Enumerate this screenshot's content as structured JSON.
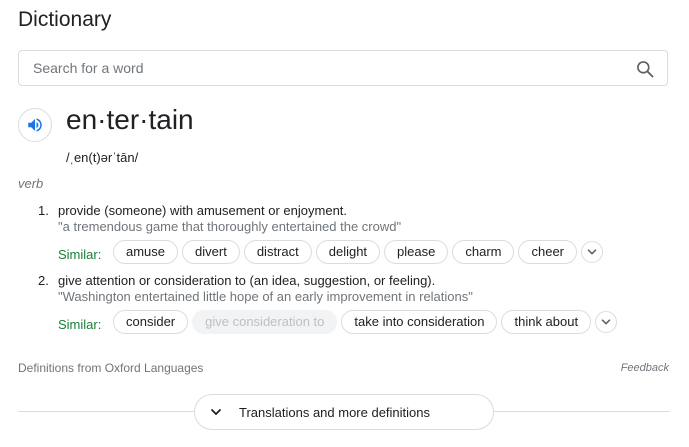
{
  "title": "Dictionary",
  "search": {
    "placeholder": "Search for a word",
    "value": "",
    "icon": "search-icon"
  },
  "entry": {
    "headword": "en·ter·tain",
    "phonetic": "/ˌen(t)ərˈtān/",
    "part_of_speech": "verb",
    "audio_icon": "speaker-icon",
    "senses": [
      {
        "number": "1.",
        "definition": "provide (someone) with amusement or enjoyment.",
        "example": "\"a tremendous game that thoroughly entertained the crowd\"",
        "similar_label": "Similar:",
        "similar": [
          {
            "label": "amuse",
            "enabled": true
          },
          {
            "label": "divert",
            "enabled": true
          },
          {
            "label": "distract",
            "enabled": true
          },
          {
            "label": "delight",
            "enabled": true
          },
          {
            "label": "please",
            "enabled": true
          },
          {
            "label": "charm",
            "enabled": true
          },
          {
            "label": "cheer",
            "enabled": true
          }
        ]
      },
      {
        "number": "2.",
        "definition": "give attention or consideration to (an idea, suggestion, or feeling).",
        "example": "\"Washington entertained little hope of an early improvement in relations\"",
        "similar_label": "Similar:",
        "similar": [
          {
            "label": "consider",
            "enabled": true
          },
          {
            "label": "give consideration to",
            "enabled": false
          },
          {
            "label": "take into consideration",
            "enabled": true
          },
          {
            "label": "think about",
            "enabled": true
          }
        ]
      }
    ]
  },
  "footer": {
    "source": "Definitions from Oxford Languages",
    "feedback": "Feedback",
    "more_button": "Translations and more definitions"
  },
  "colors": {
    "similar_label": "#188038",
    "icon_blue": "#1a73e8",
    "border": "#dadce0",
    "muted_text": "#70757a"
  }
}
